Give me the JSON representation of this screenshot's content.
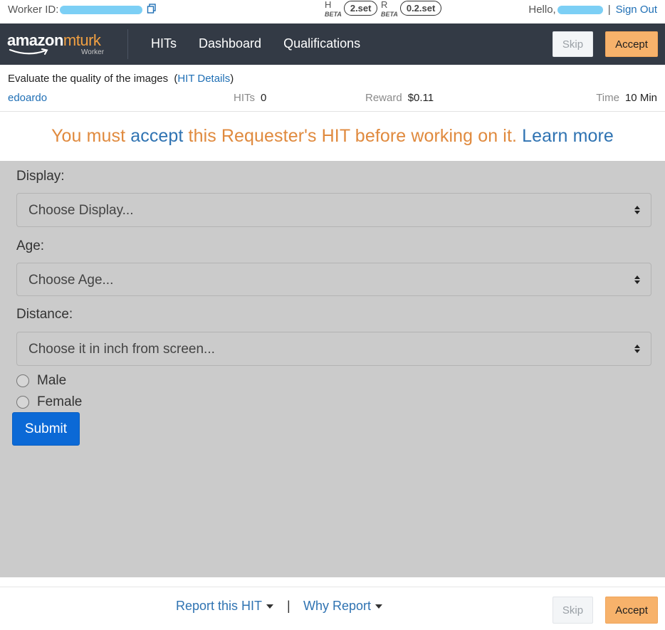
{
  "topbar": {
    "worker_id_label": "Worker ID:",
    "h_letter": "H",
    "h_beta": "BETA",
    "h_value": "2.set",
    "r_letter": "R",
    "r_beta": "BETA",
    "r_value": "0.2.set",
    "hello_label": "Hello,",
    "sign_out": "Sign Out"
  },
  "navbar": {
    "logo_amazon": "amazon",
    "logo_mturk": "mturk",
    "logo_sub": "Worker",
    "links": [
      "HITs",
      "Dashboard",
      "Qualifications"
    ],
    "skip": "Skip",
    "accept": "Accept"
  },
  "hit": {
    "title": "Evaluate the quality of the images",
    "details_open": "(",
    "details_link": "HIT Details",
    "details_close": ")",
    "requester": "edoardo",
    "hits_label": "HITs",
    "hits_value": "0",
    "reward_label": "Reward",
    "reward_value": "$0.11",
    "time_label": "Time",
    "time_value": "10 Min"
  },
  "banner": {
    "part1": "You must",
    "accept": "accept",
    "part2": "this Requester's HIT before working on it.",
    "learn_more": "Learn more"
  },
  "form": {
    "display_label": "Display:",
    "display_placeholder": "Choose Display...",
    "age_label": "Age:",
    "age_placeholder": "Choose Age...",
    "distance_label": "Distance:",
    "distance_placeholder": "Choose it in inch from screen...",
    "gender_options": [
      "Male",
      "Female"
    ],
    "submit": "Submit"
  },
  "footer": {
    "report": "Report this HIT",
    "separator": "|",
    "why_report": "Why Report",
    "skip": "Skip",
    "accept": "Accept"
  },
  "colors": {
    "navbar_bg": "#333a45",
    "accent_orange": "#f7b26b",
    "link_blue": "#1f6fb5",
    "banner_orange": "#e08a3e",
    "submit_blue": "#0b69d6",
    "task_bg": "#cbcbcb"
  }
}
